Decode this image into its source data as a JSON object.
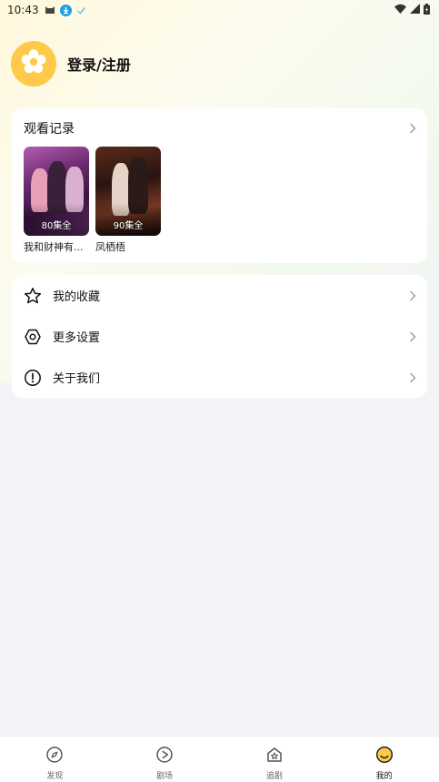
{
  "status_bar": {
    "time": "10:43",
    "icons": [
      "cat-icon",
      "download-icon",
      "check-icon",
      "wifi-icon",
      "signal-icon",
      "battery-icon"
    ]
  },
  "profile": {
    "login_label": "登录/注册",
    "avatar_icon": "flower-icon",
    "avatar_color": "#ffc94a"
  },
  "history": {
    "title": "观看记录",
    "items": [
      {
        "episodes": "80集全",
        "name": "我和财神有..."
      },
      {
        "episodes": "90集全",
        "name": "凤栖梧"
      }
    ]
  },
  "menu": {
    "items": [
      {
        "label": "我的收藏",
        "icon": "star-icon"
      },
      {
        "label": "更多设置",
        "icon": "settings-icon"
      },
      {
        "label": "关于我们",
        "icon": "info-icon"
      }
    ]
  },
  "bottom_nav": {
    "items": [
      {
        "label": "发现",
        "icon": "compass-icon"
      },
      {
        "label": "剧场",
        "icon": "play-icon"
      },
      {
        "label": "追剧",
        "icon": "house-star-icon"
      },
      {
        "label": "我的",
        "icon": "profile-icon",
        "active": true
      }
    ],
    "active_color": "#ffc94a"
  }
}
